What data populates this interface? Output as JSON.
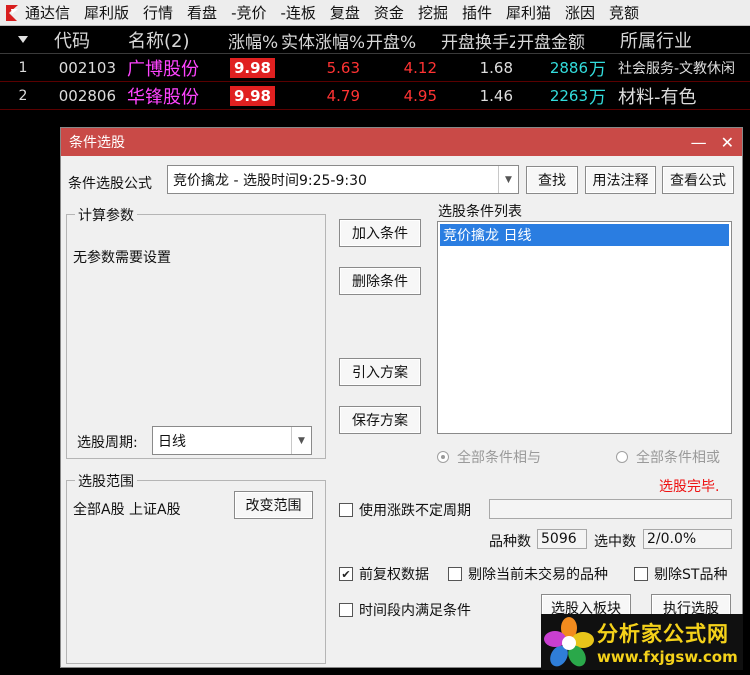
{
  "menubar": {
    "items": [
      "通达信",
      "犀利版",
      "行情",
      "看盘",
      "-竞价",
      "-连板",
      "复盘",
      "资金",
      "挖掘",
      "插件",
      "犀利猫",
      "涨因",
      "竞额"
    ]
  },
  "table": {
    "headers": {
      "code": "代码",
      "name": "名称(2)",
      "change": "涨幅%",
      "body_change": "实体涨幅%",
      "open_change": "开盘%",
      "open_turnover": "开盘换手Z",
      "open_amount": "开盘金额",
      "industry": "所属行业"
    },
    "rows": [
      {
        "idx": "1",
        "code": "002103",
        "name": "广博股份",
        "change": "9.98",
        "body_change": "5.63",
        "open_change": "4.12",
        "open_turnover": "1.68",
        "open_amount": "2886",
        "unit": "万",
        "industry": "社会服务-文教休闲"
      },
      {
        "idx": "2",
        "code": "002806",
        "name": "华锋股份",
        "change": "9.98",
        "body_change": "4.79",
        "open_change": "4.95",
        "open_turnover": "1.46",
        "open_amount": "2263",
        "unit": "万",
        "industry": "材料-有色"
      }
    ]
  },
  "dialog": {
    "title": "条件选股",
    "formula_label": "条件选股公式",
    "formula_value": "竞价擒龙      - 选股时间9:25-9:30",
    "btn_find": "查找",
    "btn_usage": "用法注释",
    "btn_view": "查看公式",
    "params_group": "计算参数",
    "no_params": "无参数需要设置",
    "period_label": "选股周期:",
    "period_value": "日线",
    "btn_add": "加入条件",
    "btn_delete": "删除条件",
    "btn_import": "引入方案",
    "btn_save": "保存方案",
    "list_label": "选股条件列表",
    "list_items": [
      "竞价擒龙  日线"
    ],
    "radio_and": "全部条件相与",
    "radio_or": "全部条件相或",
    "range_group": "选股范围",
    "range_value": "全部A股 上证A股",
    "btn_range": "改变范围",
    "status": "选股完毕.",
    "chk_uncertain": "使用涨跌不定周期",
    "count_label": "品种数",
    "count_value": "5096",
    "selected_label": "选中数",
    "selected_value": "2/0.0%",
    "chk_forward": "前复权数据",
    "chk_exclude_untraded": "剔除当前未交易的品种",
    "chk_exclude_st": "剔除ST品种",
    "chk_time_period": "时间段内满足条件",
    "btn_to_block": "选股入板块",
    "btn_execute": "执行选股"
  },
  "watermark": {
    "name": "分析家公式网",
    "url": "www.fxjgsw.com"
  }
}
